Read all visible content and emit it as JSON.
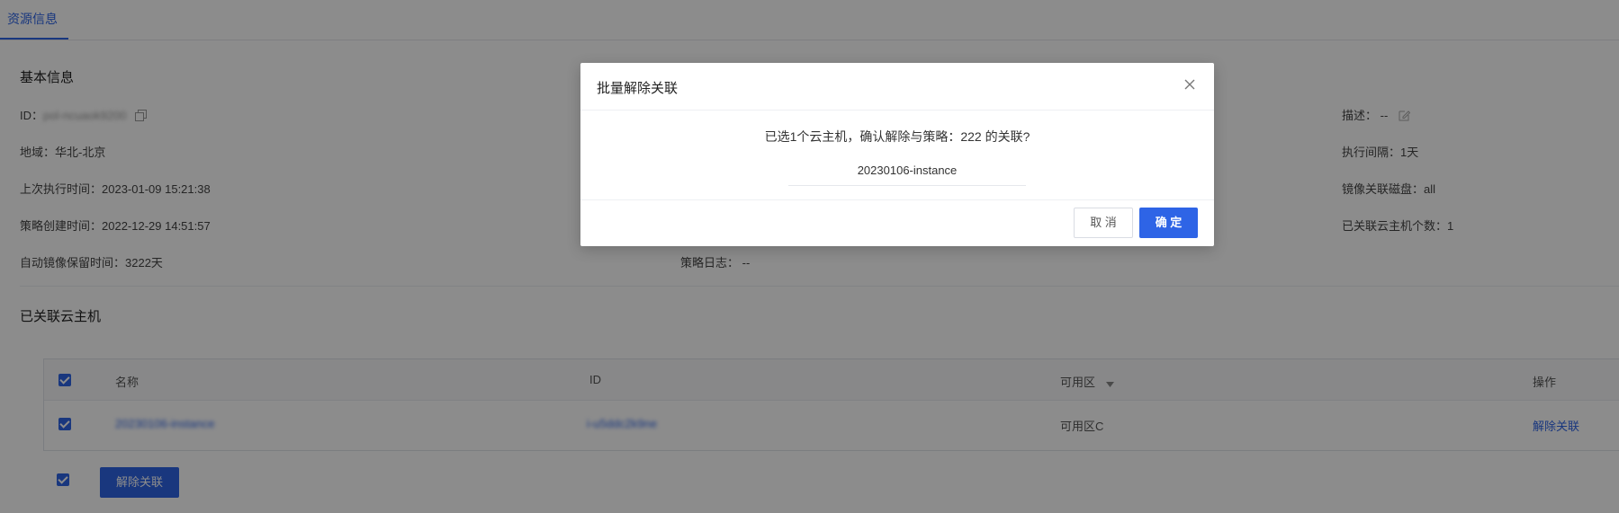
{
  "tabs": {
    "active": "资源信息"
  },
  "basic_info": {
    "title": "基本信息",
    "id_label": "ID：",
    "id_value": "pol-ncuaok9200",
    "region": "地域：华北-北京",
    "last_exec": "上次执行时间：2023-01-09 15:21:38",
    "created": "策略创建时间：2022-12-29 14:51:57",
    "retention": "自动镜像保留时间：3222天",
    "log": "策略日志：  --",
    "desc": "描述：  --",
    "interval": "执行间隔：1天",
    "disk": "镜像关联磁盘：all",
    "count": "已关联云主机个数：1"
  },
  "linked_hosts": {
    "title": "已关联云主机",
    "columns": {
      "name": "名称",
      "id": "ID",
      "zone": "可用区",
      "action": "操作"
    },
    "rows": [
      {
        "name": "20230106-instance",
        "id": "i-u5ddc2k9ne",
        "zone": "可用区C",
        "action": "解除关联"
      }
    ],
    "bulk_button": "解除关联"
  },
  "modal": {
    "title": "批量解除关联",
    "message": "已选1个云主机，确认解除与策略：222 的关联?",
    "instance": "20230106-instance",
    "cancel": "取 消",
    "ok": "确 定"
  },
  "colors": {
    "primary": "#2e64e6",
    "overlay": "rgba(0,0,0,0.45)"
  },
  "icons": [
    "copy-icon",
    "edit-icon",
    "sort-caret-icon",
    "close-icon",
    "checkbox-checked-icon"
  ]
}
